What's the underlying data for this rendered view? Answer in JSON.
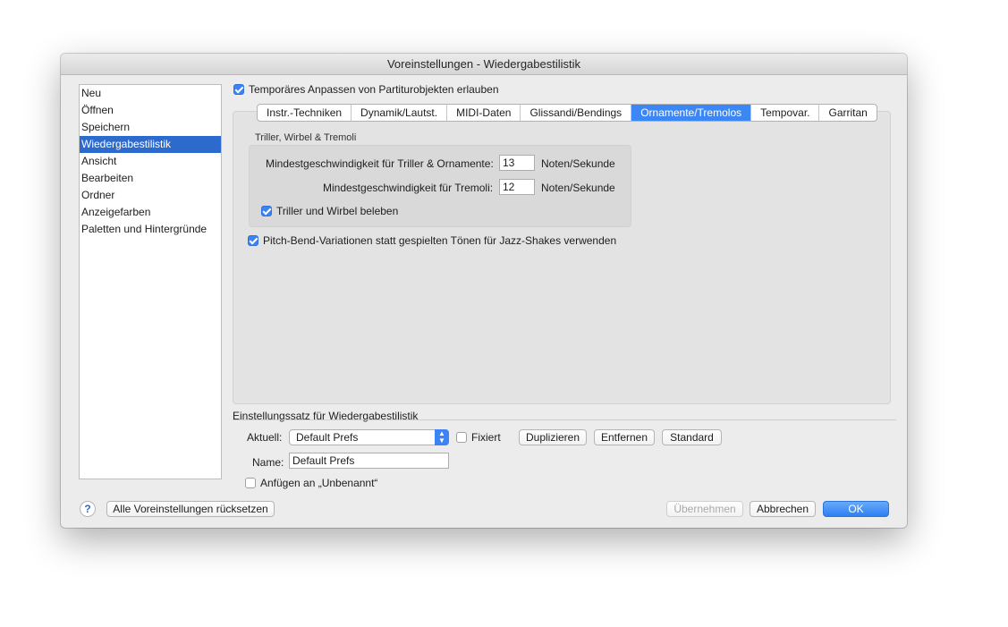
{
  "window": {
    "title": "Voreinstellungen - Wiedergabestilistik"
  },
  "sidebar": {
    "items": [
      {
        "label": "Neu"
      },
      {
        "label": "Öffnen"
      },
      {
        "label": "Speichern"
      },
      {
        "label": "Wiedergabestilistik",
        "selected": true
      },
      {
        "label": "Ansicht"
      },
      {
        "label": "Bearbeiten"
      },
      {
        "label": "Ordner"
      },
      {
        "label": "Anzeigefarben"
      },
      {
        "label": "Paletten und Hintergründe"
      }
    ]
  },
  "temp_adjust": {
    "label": "Temporäres Anpassen von Partiturobjekten erlauben",
    "checked": true
  },
  "tabs": [
    {
      "label": "Instr.-Techniken"
    },
    {
      "label": "Dynamik/Lautst."
    },
    {
      "label": "MIDI-Daten"
    },
    {
      "label": "Glissandi/Bendings"
    },
    {
      "label": "Ornamente/Tremolos",
      "active": true
    },
    {
      "label": "Tempovar."
    },
    {
      "label": "Garritan"
    }
  ],
  "trills": {
    "group_title": "Triller, Wirbel & Tremoli",
    "min_speed_trills_label": "Mindestgeschwindigkeit für Triller & Ornamente:",
    "min_speed_trills_value": "13",
    "min_speed_tremoli_label": "Mindestgeschwindigkeit für Tremoli:",
    "min_speed_tremoli_value": "12",
    "unit": "Noten/Sekunde",
    "animate_label": "Triller und Wirbel beleben",
    "animate_checked": true
  },
  "pitchbend": {
    "label": "Pitch-Bend-Variationen statt gespielten Tönen für Jazz-Shakes verwenden",
    "checked": true
  },
  "preset": {
    "section_title": "Einstellungssatz für Wiedergabestilistik",
    "current_label": "Aktuell:",
    "current_value": "Default Prefs",
    "fixed_label": "Fixiert",
    "fixed_checked": false,
    "duplicate": "Duplizieren",
    "remove": "Entfernen",
    "standard": "Standard",
    "name_label": "Name:",
    "name_value": "Default Prefs",
    "append_label": "Anfügen an „Unbenannt“",
    "append_checked": false
  },
  "footer": {
    "help": "?",
    "reset_all": "Alle Voreinstellungen rücksetzen",
    "apply": "Übernehmen",
    "cancel": "Abbrechen",
    "ok": "OK"
  },
  "colors": {
    "accent": "#3b83f7",
    "selection": "#2d6acd"
  }
}
